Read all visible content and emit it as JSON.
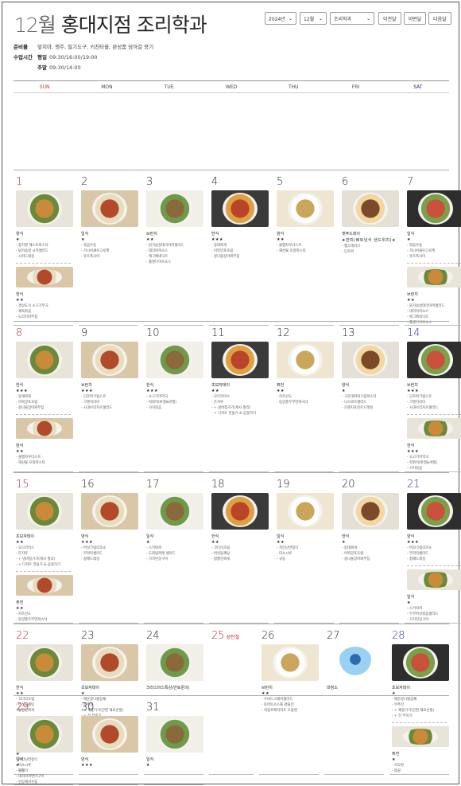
{
  "header": {
    "month": "12월",
    "title": "홍대지점  조리학과"
  },
  "controls": {
    "year": "2024년",
    "month": "12월",
    "course": "조리학과",
    "prev": "이전달",
    "current": "이번달",
    "next": "다음달"
  },
  "info": {
    "prep_label": "준비물",
    "prep_value": "앞치마, 행주, 필기도구, 키친타올, 완성품 담아갈 용기",
    "time_label": "수업시간",
    "weekday_label": "평일",
    "weekday_value": "09:30/16:00/19:00",
    "weekend_label": "주말",
    "weekend_value": "09:30/14:00"
  },
  "weekdays": [
    "SUN",
    "MON",
    "TUE",
    "WED",
    "THU",
    "FRI",
    "SAT"
  ],
  "weeks": [
    [
      {
        "day": "1",
        "menus": [
          {
            "title": "양식",
            "stars": "★",
            "items": [
              "- 참치캔 페스토파스타",
              "- 닭가슴살 시저샐러드",
              "- 시저드레싱"
            ]
          },
          {
            "title": "한식",
            "stars": "★★",
            "items": [
              "- 경상도식 소고기무국",
              "- 제육볶음",
              "- 도라지파무침"
            ]
          }
        ]
      },
      {
        "day": "2",
        "menus": [
          {
            "title": "일식",
            "stars": "★",
            "items": [
              "- 볶음우동",
              "- 가니쉬새우고로케",
              "- 유즈폭사이"
            ]
          }
        ]
      },
      {
        "day": "3",
        "menus": [
          {
            "title": "브런치",
            "stars": "★★",
            "items": [
              "- 닭가슴살데리야끼샐러드",
              "- 데리야끼소스",
              "- 에그베네딕트",
              "- 홀랜다이즈소스"
            ]
          }
        ]
      },
      {
        "day": "4",
        "menus": [
          {
            "title": "한식",
            "stars": "★★★",
            "items": [
              "- 동태찌개",
              "- 어묵양포조림",
              "- 콩나물장아찌무침"
            ]
          }
        ]
      },
      {
        "day": "5",
        "menus": [
          {
            "title": "양식",
            "stars": "★★",
            "items": [
              "- 클램차우더스프",
              "- 해산물 오일파스타"
            ]
          }
        ]
      },
      {
        "day": "6",
        "menus": [
          {
            "title": "캣푸드데이",
            "stars": "★반미(베트남식 샌드위치)★",
            "items": [
              "- 햄스테이크",
              "- 단호박"
            ]
          }
        ]
      },
      {
        "day": "7",
        "menus": [
          {
            "title": "일식",
            "stars": "★",
            "items": [
              "- 볶음우동",
              "- 가니쉬새우고로케",
              "- 유즈폭사이"
            ]
          },
          {
            "title": "브런치",
            "stars": "★★",
            "items": [
              "- 닭가슴살데리야끼샐러드",
              "- 데리야끼소스",
              "- 에그베네딕트",
              "- 홀랜다이즈소스"
            ]
          }
        ]
      }
    ],
    [
      {
        "day": "8",
        "menus": [
          {
            "title": "한식",
            "stars": "★★★",
            "items": [
              "- 동태찌개",
              "- 어묵양포조림",
              "- 콩나물장아찌무침"
            ]
          },
          {
            "title": "양식",
            "stars": "★★",
            "items": [
              "- 클램차우더스프",
              "- 해산물 오일파스타"
            ]
          }
        ]
      },
      {
        "day": "9",
        "menus": [
          {
            "title": "브런치",
            "stars": "★★★",
            "items": [
              "- 단호박크림스프",
              "- 크렌치라이",
              "- 사과브리치즈샐러드"
            ]
          }
        ]
      },
      {
        "day": "10",
        "menus": [
          {
            "title": "한식",
            "stars": "★★★",
            "items": [
              "- 소고기미역국",
              "- 떡볶이(바질&바질)",
              "- 가지볶음"
            ]
          }
        ]
      },
      {
        "day": "11",
        "menus": [
          {
            "title": "초보자데이",
            "stars": "★★",
            "items": [
              "- 오므라이스",
              "- 돈지루",
              "- + 냉바칭가기(계사 칠리)",
              "- + 디저트 만들기 & 응용하기"
            ]
          }
        ]
      },
      {
        "day": "12",
        "menus": [
          {
            "title": "퓨전",
            "stars": "★★",
            "items": [
              "- 카츠산도",
              "- 동양풍두부면파스타"
            ]
          }
        ]
      },
      {
        "day": "13",
        "menus": [
          {
            "title": "양식",
            "stars": "★",
            "items": [
              "- 구운대파와크림파스타",
              "- 니스와즈샐러드",
              "- 오렌지포인트드레싱"
            ]
          }
        ]
      },
      {
        "day": "14",
        "menus": [
          {
            "title": "브런치",
            "stars": "★★★",
            "items": [
              "- 단호박크림스프",
              "- 크렌치라이",
              "- 사과브리치즈샐러드"
            ]
          },
          {
            "title": "한식",
            "stars": "★★★",
            "items": [
              "- 소고기미역국",
              "- 떡볶이(바질&바질)",
              "- 가지볶음"
            ]
          }
        ]
      }
    ],
    [
      {
        "day": "15",
        "menus": [
          {
            "title": "초보자데이",
            "stars": "★★",
            "items": [
              "- 오므라이스",
              "- 돈지루",
              "- + 냉바칭가기(계사 칠리)",
              "- + 디저트 만들기 & 응용하기"
            ]
          },
          {
            "title": "퓨전",
            "stars": "★★",
            "items": [
              "- 카츠산도",
              "- 동양풍두부면파스타"
            ]
          }
        ]
      },
      {
        "day": "16",
        "menus": [
          {
            "title": "양식",
            "stars": "★★★",
            "items": [
              "- 버섯크림리조또",
              "- 부라타샐러드",
              "- 참깨드레싱"
            ]
          }
        ]
      },
      {
        "day": "17",
        "menus": [
          {
            "title": "일식",
            "stars": "★",
            "items": [
              "- 스키야끼",
              "- 도화빛파래 샐러드",
              "- 가지된장구이"
            ]
          }
        ]
      },
      {
        "day": "18",
        "menus": [
          {
            "title": "한식",
            "stars": "★★",
            "items": [
              "- 코다리조림",
              "- 버섯들깨탕",
              "- 밤빵전찌게"
            ]
          }
        ]
      },
      {
        "day": "19",
        "menus": [
          {
            "title": "일식",
            "stars": "★★",
            "items": [
              "- 치킨난반정식",
              "- 미소시루",
              "- 규동"
            ]
          }
        ]
      },
      {
        "day": "20",
        "menus": [
          {
            "title": "한식",
            "stars": "★",
            "items": [
              "- 동태찌개",
              "- 어묵양포조림",
              "- 콩나물장아찌무침"
            ]
          }
        ]
      },
      {
        "day": "21",
        "menus": [
          {
            "title": "양식",
            "stars": "★★★",
            "items": [
              "- 버섯크림리조또",
              "- 부라타샐러드",
              "- 참깨드레싱"
            ]
          },
          {
            "title": "일식",
            "stars": "★",
            "items": [
              "- 스키야끼",
              "- 두부버섯볶음샐러드",
              "- 가지된장구이"
            ]
          }
        ]
      }
    ],
    [
      {
        "day": "22",
        "menus": [
          {
            "title": "한식",
            "stars": "★★",
            "items": [
              "- 코다리조림",
              "- 버섯들깨탕",
              "- 밤빵전찌게"
            ]
          },
          {
            "title": "일식",
            "stars": "★",
            "items": [
              "- 치킨난반정식",
              "- 미소시루",
              "- 규동"
            ]
          }
        ]
      },
      {
        "day": "23",
        "menus": [
          {
            "title": "초보자데이",
            "stars": "★",
            "items": [
              "- 매운콩나물잡채",
              "- 부추전",
              "- + 재봉기기(간편 재료손질)",
              "- + 전 부치기"
            ]
          }
        ]
      },
      {
        "day": "24",
        "menus": [
          {
            "title": "크리스마스특강(안토문의)",
            "stars": "",
            "items": []
          }
        ]
      },
      {
        "day": "25",
        "holiday": "성탄절",
        "menus": []
      },
      {
        "day": "26",
        "menus": [
          {
            "title": "브런치",
            "stars": "★★",
            "items": [
              "- 수비드크래미샐러드",
              "- 토마토소스를 곁들인",
              "- 쉬림프베지미트 오믈렛"
            ]
          }
        ]
      },
      {
        "day": "27",
        "menus": [
          {
            "title": "대청소",
            "stars": "",
            "items": []
          }
        ]
      },
      {
        "day": "28",
        "menus": [
          {
            "title": "초보자데이",
            "stars": "★",
            "items": [
              "- 매운콩나물잡채",
              "- 부추전",
              "- + 재봉기기(간편 재료손질)",
              "- + 전 부치기"
            ]
          },
          {
            "title": "퓨전",
            "stars": "★",
            "items": [
              "- 카오팟",
              "- 똠꿍"
            ]
          }
        ]
      }
    ],
    [
      {
        "day": "29",
        "menus": [
          {
            "title": "일식",
            "stars": "★",
            "items": [
              "- 돈부리",
              "- 데리야끼연어구이",
              "- 된장계지우동"
            ]
          }
        ]
      },
      {
        "day": "30",
        "menus": [
          {
            "title": "양식",
            "stars": "★★★",
            "items": []
          }
        ]
      },
      {
        "day": "31",
        "menus": [
          {
            "title": "일식",
            "stars": "★",
            "items": []
          }
        ]
      }
    ]
  ]
}
